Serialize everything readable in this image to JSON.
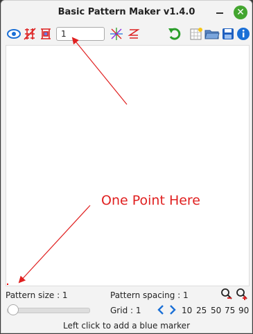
{
  "window": {
    "title": "Basic Pattern Maker v1.4.0"
  },
  "toolbar": {
    "pattern_value": "1",
    "icons": [
      "eye-icon",
      "flip-icon",
      "grid-icon",
      "star-icon",
      "zigzag-icon",
      "undo-icon",
      "new-icon",
      "open-icon",
      "save-icon",
      "info-icon"
    ]
  },
  "annotation": {
    "text": "One Point Here"
  },
  "bottom": {
    "pattern_size": "Pattern size : 1",
    "pattern_spacing": "Pattern spacing : 1",
    "grid": "Grid : 1",
    "grid_presets": [
      "10",
      "25",
      "50",
      "75",
      "90"
    ],
    "status": "Left click to add a blue marker",
    "slider_value": 0
  },
  "colors": {
    "accent_green": "#43a52f",
    "annotation_red": "#e02020",
    "blue": "#1a6fd6"
  }
}
